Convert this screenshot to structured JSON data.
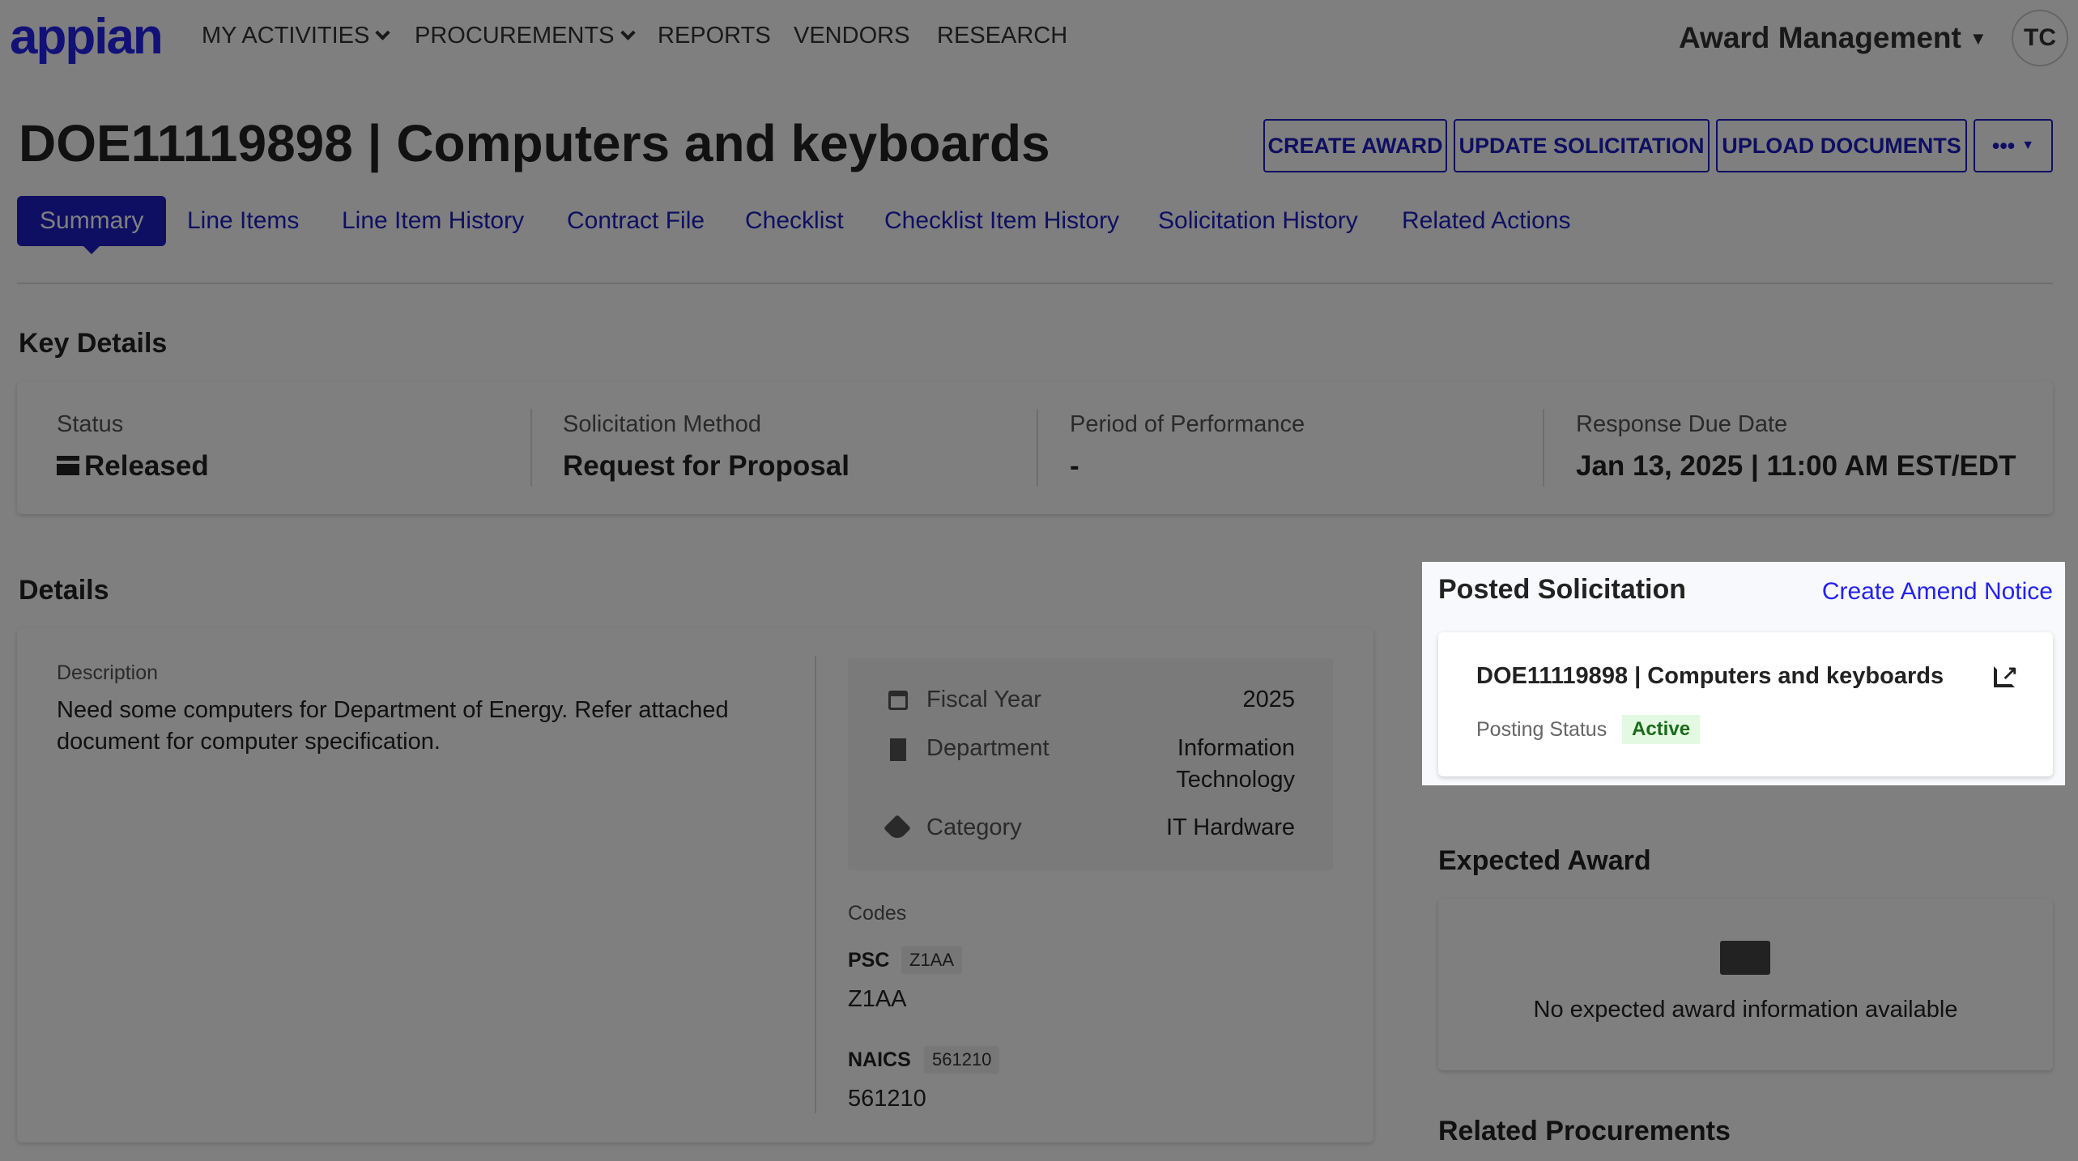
{
  "nav": {
    "logo": "appian",
    "items": [
      "MY ACTIVITIES",
      "PROCUREMENTS",
      "REPORTS",
      "VENDORS",
      "RESEARCH"
    ],
    "app_switcher": "Award Management",
    "avatar": "TC"
  },
  "page": {
    "title": "DOE11119898 | Computers and keyboards"
  },
  "actions": {
    "create_award": "CREATE AWARD",
    "update_solicitation": "UPDATE SOLICITATION",
    "upload_documents": "UPLOAD DOCUMENTS",
    "more": "•••"
  },
  "tabs": [
    "Summary",
    "Line Items",
    "Line Item History",
    "Contract File",
    "Checklist",
    "Checklist Item History",
    "Solicitation History",
    "Related Actions"
  ],
  "key_details": {
    "heading": "Key Details",
    "items": [
      {
        "label": "Status",
        "value": "Released",
        "icon": "archive-icon"
      },
      {
        "label": "Solicitation Method",
        "value": "Request for Proposal"
      },
      {
        "label": "Period of Performance",
        "value": "-"
      },
      {
        "label": "Response Due Date",
        "value": "Jan 13, 2025 | 11:00 AM EST/EDT"
      }
    ]
  },
  "details": {
    "heading": "Details",
    "description_label": "Description",
    "description_lines": [
      "Need some computers for Department of Energy. Refer attached",
      "document for computer specification."
    ],
    "fiscal_year_label": "Fiscal Year",
    "fiscal_year": "2025",
    "department_label": "Department",
    "department_lines": [
      "Information",
      "Technology"
    ],
    "category_label": "Category",
    "category": "IT Hardware",
    "codes_label": "Codes",
    "psc_label": "PSC",
    "psc_badge": "Z1AA",
    "psc_value": "Z1AA",
    "naics_label": "NAICS",
    "naics_badge": "561210",
    "naics_value": "561210"
  },
  "posted": {
    "heading": "Posted Solicitation",
    "amend_link": "Create Amend Notice",
    "card_title": "DOE11119898 | Computers and keyboards",
    "posting_status_label": "Posting Status",
    "posting_status": "Active"
  },
  "expected": {
    "heading": "Expected Award",
    "empty": "No expected award information available"
  },
  "related": {
    "heading": "Related Procurements"
  },
  "colors": {
    "accent": "#1d1ec4",
    "active_badge_bg": "#e3f9e1",
    "active_badge_text": "#1a6b1a",
    "overlay": "rgba(0,0,0,0.5)"
  }
}
